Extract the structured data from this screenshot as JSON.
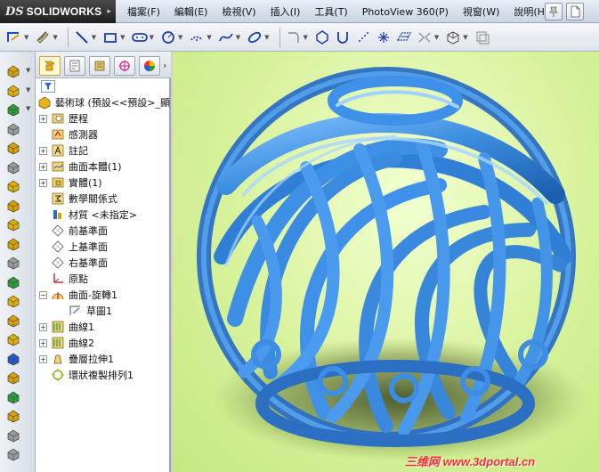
{
  "app": {
    "logo_ds": "DS",
    "logo_name": "SOLIDWORKS",
    "logo_arrow": "▸"
  },
  "menu": {
    "items": [
      "檔案(F)",
      "編輯(E)",
      "檢視(V)",
      "插入(I)",
      "工具(T)",
      "PhotoView 360(P)",
      "視窗(W)",
      "說明(H)"
    ],
    "pin_icon": "pushpin-icon",
    "new_icon": "new-document-icon"
  },
  "sketch_toolbar": {
    "tools": [
      {
        "icon": "sketch-icon",
        "glyph": "⌐"
      },
      {
        "icon": "smart-dimension-icon",
        "glyph": "◇"
      },
      {
        "icon": "line-icon",
        "glyph": "╲"
      },
      {
        "icon": "rectangle-icon",
        "glyph": "▭"
      },
      {
        "icon": "slot-icon",
        "glyph": "⊂⊃"
      },
      {
        "icon": "circle-icon",
        "glyph": "⊘"
      },
      {
        "icon": "arc-icon",
        "glyph": "◌"
      },
      {
        "icon": "spline-icon",
        "glyph": "∿"
      },
      {
        "icon": "ellipse-icon",
        "glyph": "⬭"
      },
      {
        "icon": "fillet-icon",
        "glyph": "⌐"
      },
      {
        "icon": "polygon-icon",
        "glyph": "⬡"
      },
      {
        "icon": "parabola-icon",
        "glyph": "∪"
      },
      {
        "icon": "point-grid-icon",
        "glyph": "⁘"
      },
      {
        "icon": "point-icon",
        "glyph": "✳"
      },
      {
        "icon": "plane-icon",
        "glyph": "⊞"
      },
      {
        "icon": "text-icon",
        "glyph": "⋈"
      },
      {
        "icon": "convert-entities-icon",
        "glyph": "⬚"
      },
      {
        "icon": "offset-entities-icon",
        "glyph": "⧉"
      }
    ]
  },
  "left_toolbar": {
    "icons": [
      "extruded-boss-icon",
      "revolved-boss-icon",
      "swept-boss-icon",
      "lofted-boss-icon",
      "boundary-boss-icon",
      "thicken-icon",
      "extruded-cut-icon",
      "revolved-cut-icon",
      "fillet-feature-icon",
      "chamfer-icon",
      "rib-icon",
      "shell-icon",
      "draft-icon",
      "dome-icon",
      "wrap-icon",
      "linear-pattern-icon",
      "mirror-icon",
      "reference-geometry-icon",
      "curves-icon",
      "instant3d-icon",
      "deform-icon"
    ]
  },
  "feature_manager": {
    "tabs": [
      "featuremanager-tab-icon",
      "propertymanager-tab-icon",
      "configurationmanager-tab-icon",
      "dimxpert-tab-icon",
      "display-manager-tab-icon"
    ],
    "tab_more": "›",
    "filter_icon": "filter-icon",
    "root": "藝術球 (預設<<預設>_顯",
    "items": [
      {
        "label": "歷程",
        "expandable": true,
        "icon": "history-icon",
        "indent": 1
      },
      {
        "label": "感測器",
        "expandable": false,
        "icon": "sensors-icon",
        "indent": 1
      },
      {
        "label": "註記",
        "expandable": true,
        "icon": "annotations-icon",
        "indent": 1
      },
      {
        "label": "曲面本體(1)",
        "expandable": true,
        "icon": "surface-bodies-icon",
        "indent": 1
      },
      {
        "label": "實體(1)",
        "expandable": true,
        "icon": "solid-bodies-icon",
        "indent": 1
      },
      {
        "label": "數學關係式",
        "expandable": false,
        "icon": "equations-icon",
        "indent": 1
      },
      {
        "label": "材質 <未指定>",
        "expandable": false,
        "icon": "material-icon",
        "indent": 1
      },
      {
        "label": "前基準面",
        "expandable": false,
        "icon": "front-plane-icon",
        "indent": 1
      },
      {
        "label": "上基準面",
        "expandable": false,
        "icon": "top-plane-icon",
        "indent": 1
      },
      {
        "label": "右基準面",
        "expandable": false,
        "icon": "right-plane-icon",
        "indent": 1
      },
      {
        "label": "原點",
        "expandable": false,
        "icon": "origin-icon",
        "indent": 1
      },
      {
        "label": "曲面-旋轉1",
        "expandable": true,
        "expanded": true,
        "icon": "surface-revolve-icon",
        "indent": 1
      },
      {
        "label": "草圖1",
        "expandable": false,
        "icon": "sketch-tree-icon",
        "indent": 2
      },
      {
        "label": "曲線1",
        "expandable": true,
        "icon": "curve-icon",
        "indent": 1
      },
      {
        "label": "曲線2",
        "expandable": true,
        "icon": "curve-icon",
        "indent": 1
      },
      {
        "label": "疊層拉伸1",
        "expandable": true,
        "icon": "loft-icon",
        "indent": 1
      },
      {
        "label": "環狀複製排列1",
        "expandable": false,
        "icon": "circular-pattern-icon",
        "indent": 1
      }
    ]
  },
  "viewport": {
    "model_name": "art-ball-model",
    "model_color": "#3f8fe0",
    "background": "#d7f29a"
  },
  "watermark": "三维网 www.3dportal.cn"
}
